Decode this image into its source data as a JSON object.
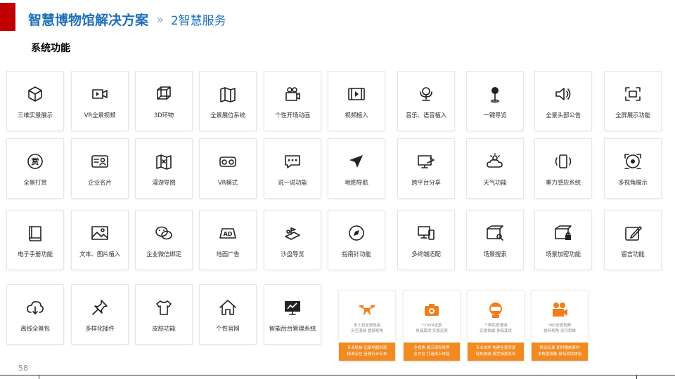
{
  "header": {
    "title": "智慧博物馆解决方案",
    "separator": "»",
    "section": "2智慧服务"
  },
  "subtitle": "系统功能",
  "page_number": "58",
  "accent_color": "#c00000",
  "title_color": "#1f6fb8",
  "orange_color": "#f28a22",
  "features": [
    {
      "label": "三维实景展示",
      "icon": "cube-icon"
    },
    {
      "label": "VR全景视频",
      "icon": "video-camera-icon"
    },
    {
      "label": "3D环物",
      "icon": "3d-box-icon"
    },
    {
      "label": "全景展位系统",
      "icon": "map-fold-icon"
    },
    {
      "label": "个性开场动画",
      "icon": "camera-person-icon"
    },
    {
      "label": "视频植入",
      "icon": "film-icon"
    },
    {
      "label": "音乐、语音植入",
      "icon": "microphone-icon"
    },
    {
      "label": "一键导览",
      "icon": "pin-icon"
    },
    {
      "label": "全景头部公告",
      "icon": "speaker-icon"
    },
    {
      "label": "全屏展示功能",
      "icon": "fullscreen-icon"
    },
    {
      "label": "全景打赏",
      "icon": "reward-icon"
    },
    {
      "label": "企业名片",
      "icon": "id-card-icon"
    },
    {
      "label": "漫游导图",
      "icon": "map-icon"
    },
    {
      "label": "VR模式",
      "icon": "vr-glasses-icon"
    },
    {
      "label": "说一说功能",
      "icon": "chat-icon"
    },
    {
      "label": "地图导航",
      "icon": "navigation-arrow-icon"
    },
    {
      "label": "跨平台分享",
      "icon": "share-screen-icon"
    },
    {
      "label": "天气功能",
      "icon": "weather-icon"
    },
    {
      "label": "重力感应系统",
      "icon": "gravity-phone-icon"
    },
    {
      "label": "多视角展示",
      "icon": "multi-view-icon"
    },
    {
      "label": "电子手册功能",
      "icon": "book-icon"
    },
    {
      "label": "文本、图片植入",
      "icon": "image-icon"
    },
    {
      "label": "企业微信绑定",
      "icon": "wechat-icon"
    },
    {
      "label": "地面广告",
      "icon": "ad-icon"
    },
    {
      "label": "沙盘导览",
      "icon": "sandbox-icon"
    },
    {
      "label": "指南针功能",
      "icon": "compass-icon"
    },
    {
      "label": "多终端适配",
      "icon": "devices-icon"
    },
    {
      "label": "场景搜索",
      "icon": "scene-search-icon"
    },
    {
      "label": "场景加密功能",
      "icon": "scene-lock-icon"
    },
    {
      "label": "留言功能",
      "icon": "edit-icon"
    },
    {
      "label": "离线全景包",
      "icon": "cloud-download-icon"
    },
    {
      "label": "多样化插件",
      "icon": "pushpin-icon"
    },
    {
      "label": "皮肤功能",
      "icon": "shirt-icon"
    },
    {
      "label": "个性官网",
      "icon": "home-icon"
    },
    {
      "label": "智能后台管理系统",
      "icon": "dashboard-icon"
    }
  ],
  "orange_cards": [
    {
      "icon": "drone-icon",
      "line1": "无人机全景航拍",
      "line2": "天空漫游 震撼视角",
      "bottom1": "专业航拍 记录地貌风貌",
      "bottom2": "精准定位 呈现行业专布"
    },
    {
      "icon": "camera-icon",
      "line1": "720VR全景",
      "line2": "身临其境 实景还原",
      "bottom1": "全视角 展示现实世界",
      "bottom2": "全方位 打造线上体验"
    },
    {
      "icon": "vr-head-icon",
      "line1": "三维实景漫游",
      "line2": "实景拍摄 身临其境",
      "bottom1": "专业技术 构建全景实景",
      "bottom2": "轻松旅游 感受场景风光"
    },
    {
      "icon": "movie-camera-icon",
      "line1": "360全景视频",
      "line2": "独特视角 灵巧思维",
      "bottom1": "移动记录 即时播放素材",
      "bottom2": "多角度观看 身临其境体验"
    }
  ]
}
